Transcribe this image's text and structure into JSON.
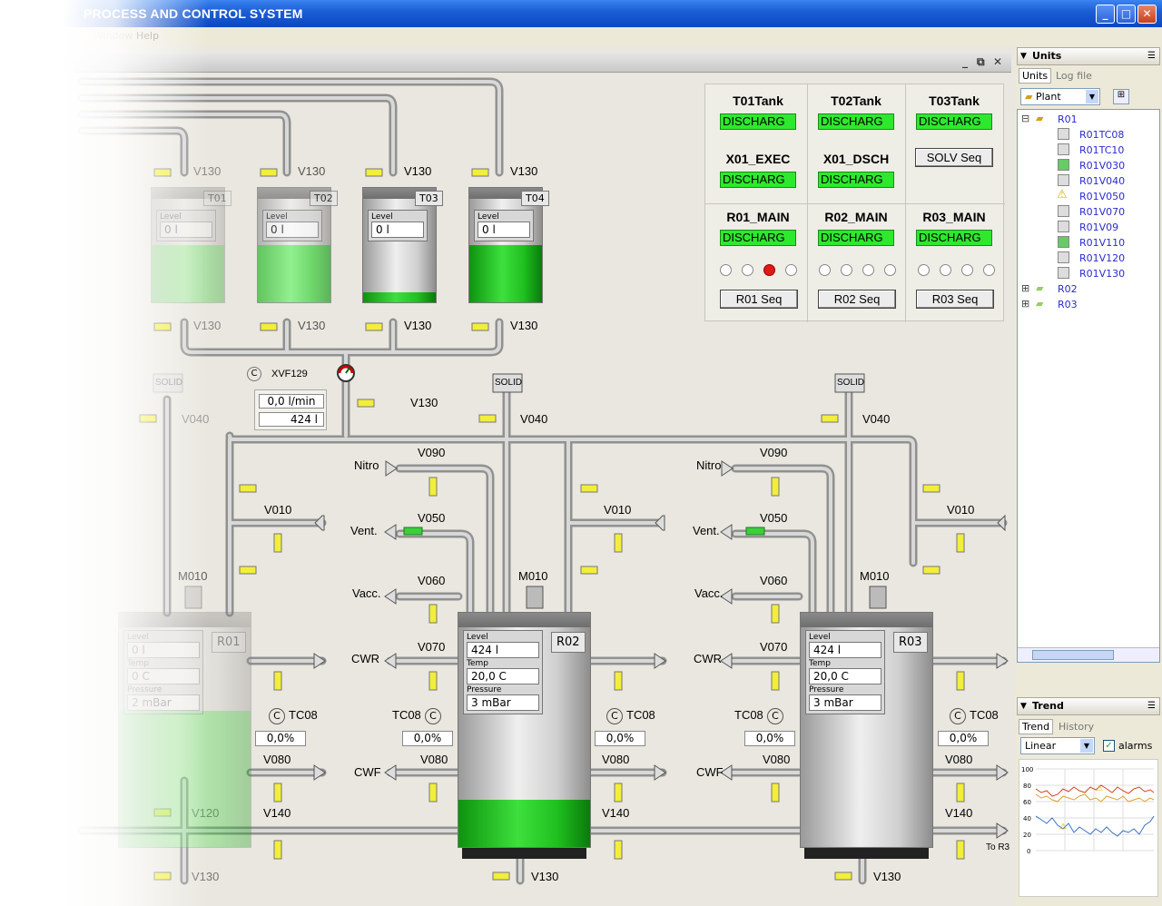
{
  "window": {
    "title": "PROCESS AND CONTROL SYSTEM"
  },
  "menu": [
    "Window",
    "Help"
  ],
  "panel": {
    "cells": [
      {
        "label": "T01Tank",
        "status": "DISCHARG"
      },
      {
        "label": "T02Tank",
        "status": "DISCHARG"
      },
      {
        "label": "T03Tank",
        "status": "DISCHARG"
      },
      {
        "label": "X01_EXEC",
        "status": "DISCHARG"
      },
      {
        "label": "X01_DSCH",
        "status": "DISCHARG"
      },
      {
        "label": "R01_MAIN",
        "status": "DISCHARG"
      },
      {
        "label": "R02_MAIN",
        "status": "DISCHARG"
      },
      {
        "label": "R03_MAIN",
        "status": "DISCHARG"
      }
    ],
    "solv_button": "SOLV Seq",
    "seq_buttons": [
      "R01 Seq",
      "R02 Seq",
      "R03 Seq"
    ],
    "r01_active_step": 3
  },
  "feed_tanks": [
    {
      "tag": "T01",
      "level": "0 l",
      "fill_fraction": 0.5
    },
    {
      "tag": "T02",
      "level": "0 l",
      "fill_fraction": 0.5
    },
    {
      "tag": "T03",
      "level": "0 l",
      "fill_fraction": 0.1
    },
    {
      "tag": "T04",
      "level": "0 l",
      "fill_fraction": 0.5
    }
  ],
  "valve_labels": {
    "v130": "V130",
    "v040": "V040",
    "v090": "V090",
    "v050": "V050",
    "v060": "V060",
    "v070": "V070",
    "v080": "V080",
    "v010": "V010",
    "v120": "V120",
    "v140": "V140",
    "m010": "M010",
    "solid": "SOLID"
  },
  "flow_meter": {
    "tag": "XVF129",
    "flow": "0,0 l/min",
    "total": "424 l"
  },
  "line_labels": {
    "nitro": "Nitro",
    "vent": "Vent.",
    "vacc": "Vacc.",
    "cwr": "CWR",
    "cwf": "CWF",
    "to_r3": "To R3"
  },
  "reactors": [
    {
      "tag": "R01",
      "level": "0 l",
      "temp": "0 C",
      "pressure": "2 mBar",
      "tc": "TC08",
      "tc_value": "0,0%",
      "fill_fraction": 0.75
    },
    {
      "tag": "R02",
      "level": "424 l",
      "temp": "20,0 C",
      "pressure": "3 mBar",
      "tc": "TC08",
      "tc_value": "0,0%",
      "tc_right": "TC08",
      "tc_right_value": "0,0%",
      "fill_fraction": 0.2
    },
    {
      "tag": "R03",
      "level": "424 l",
      "temp": "20,0 C",
      "pressure": "3 mBar",
      "tc": "TC08",
      "tc_value": "0,0%",
      "tc_right": "TC08",
      "tc_right_value": "0,0%",
      "fill_fraction": 0
    }
  ],
  "field_labels": {
    "level": "Level",
    "temp": "Temp",
    "pressure": "Pressure"
  },
  "units_pane": {
    "title": "Units",
    "tabs": [
      "Units",
      "Log file"
    ],
    "combo": "Plant",
    "tree": [
      {
        "name": "R01",
        "level": 0
      },
      {
        "name": "R01TC08",
        "level": 1
      },
      {
        "name": "R01TC10",
        "level": 1
      },
      {
        "name": "R01V030",
        "level": 1
      },
      {
        "name": "R01V040",
        "level": 1
      },
      {
        "name": "R01V050",
        "level": 1
      },
      {
        "name": "R01V070",
        "level": 1
      },
      {
        "name": "R01V09",
        "level": 1
      },
      {
        "name": "R01V110",
        "level": 1
      },
      {
        "name": "R01V120",
        "level": 1
      },
      {
        "name": "R01V130",
        "level": 1
      },
      {
        "name": "R02",
        "level": 0
      },
      {
        "name": "R03",
        "level": 0
      }
    ]
  },
  "trend_pane": {
    "title": "Trend",
    "tabs": [
      "Trend",
      "History"
    ],
    "scale": "Linear",
    "alarms_label": "alarms",
    "y_ticks": [
      "100",
      "80",
      "60",
      "40",
      "20",
      "0"
    ]
  }
}
